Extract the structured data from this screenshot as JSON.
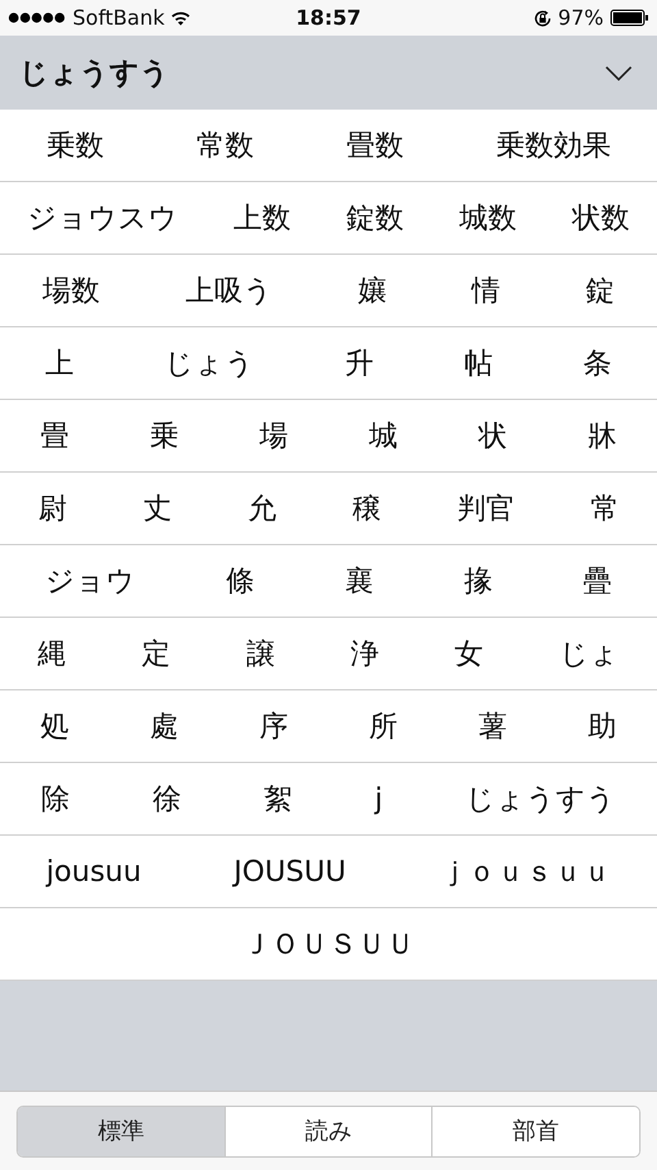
{
  "status_bar": {
    "carrier": "SoftBank",
    "time": "18:57",
    "battery": "97%"
  },
  "header": {
    "title": "じょうすう",
    "expanded": true
  },
  "candidate_rows": [
    [
      "乗数",
      "常数",
      "畳数",
      "乗数効果"
    ],
    [
      "ジョウスウ",
      "上数",
      "錠数",
      "城数",
      "状数"
    ],
    [
      "場数",
      "上吸う",
      "孃",
      "情",
      "錠"
    ],
    [
      "上",
      "じょう",
      "升",
      "帖",
      "条"
    ],
    [
      "畳",
      "乗",
      "場",
      "城",
      "状",
      "牀"
    ],
    [
      "尉",
      "丈",
      "允",
      "穣",
      "判官",
      "常"
    ],
    [
      "ジョウ",
      "條",
      "襄",
      "掾",
      "疊"
    ],
    [
      "縄",
      "定",
      "譲",
      "浄",
      "女",
      "じょ"
    ],
    [
      "処",
      "處",
      "序",
      "所",
      "薯",
      "助"
    ],
    [
      "除",
      "徐",
      "絮",
      "j",
      "じょうすう"
    ],
    [
      "jousuu",
      "JOUSUU",
      "ｊｏｕｓｕｕ"
    ],
    [
      "ＪＯＵＳＵＵ"
    ]
  ],
  "tabs": [
    {
      "label": "標準",
      "selected": true
    },
    {
      "label": "読み",
      "selected": false
    },
    {
      "label": "部首",
      "selected": false
    }
  ]
}
